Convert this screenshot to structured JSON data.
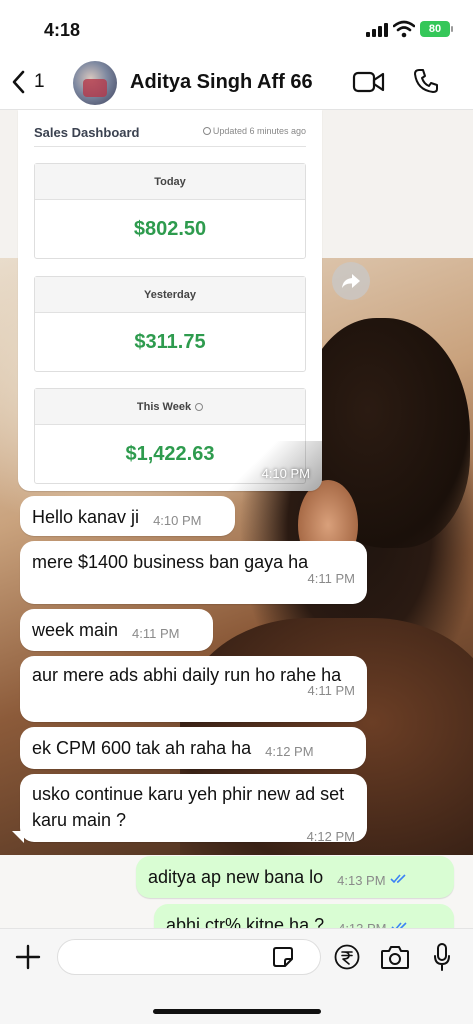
{
  "status_bar": {
    "time": "4:18",
    "battery": "80"
  },
  "header": {
    "back_count": "1",
    "contact_name": "Aditya Singh Aff 66"
  },
  "dashboard": {
    "title": "Sales Dashboard",
    "updated": "Updated 6 minutes ago",
    "cards": [
      {
        "label": "Today",
        "value": "$802.50"
      },
      {
        "label": "Yesterday",
        "value": "$311.75"
      },
      {
        "label": "This Week",
        "value": "$1,422.63"
      }
    ],
    "time": "4:10 PM"
  },
  "messages": [
    {
      "text": "Hello kanav ji",
      "time": "4:10 PM",
      "direction": "in"
    },
    {
      "text": "mere $1400 business ban gaya ha",
      "time": "4:11 PM",
      "direction": "in"
    },
    {
      "text": "week main",
      "time": "4:11 PM",
      "direction": "in"
    },
    {
      "text": "aur mere ads abhi daily run ho rahe ha",
      "time": "4:11 PM",
      "direction": "in"
    },
    {
      "text": "ek CPM 600 tak ah raha ha",
      "time": "4:12 PM",
      "direction": "in"
    },
    {
      "text": "usko continue karu yeh phir new ad set karu main ?",
      "time": "4:12 PM",
      "direction": "in"
    },
    {
      "text": "aditya ap new bana lo",
      "time": "4:13 PM",
      "direction": "out"
    },
    {
      "text": "abhi ctr% kitne ha ?",
      "time": "4:13 PM",
      "direction": "out"
    }
  ],
  "composer": {
    "placeholder": ""
  },
  "colors": {
    "accent_green": "#2e9b4e",
    "outgoing_bubble": "#d9fdd3",
    "read_ticks": "#3b82f6"
  },
  "icons": [
    "back-chevron-icon",
    "video-call-icon",
    "phone-icon",
    "forward-icon",
    "plus-icon",
    "sticker-icon",
    "rupee-icon",
    "camera-icon",
    "mic-icon"
  ]
}
